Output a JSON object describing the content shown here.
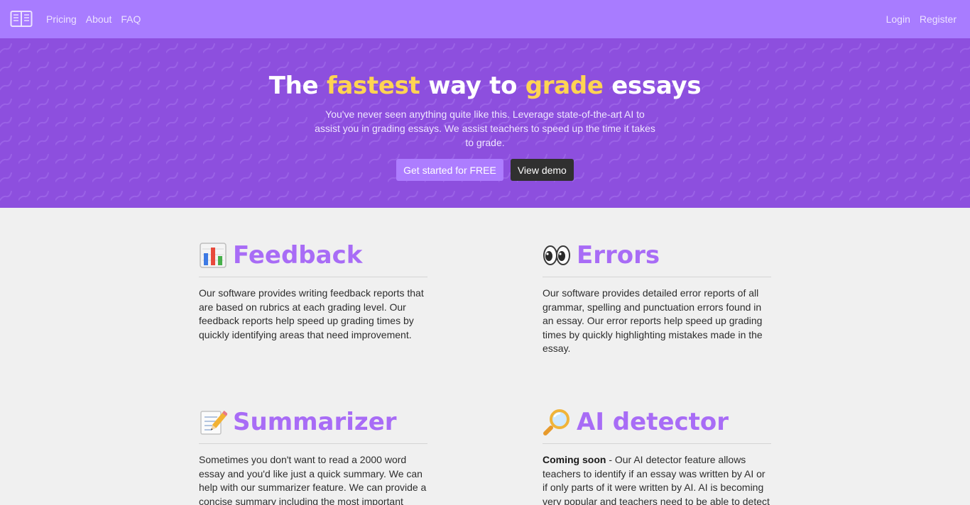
{
  "nav": {
    "logo": "book-icon",
    "links": [
      "Pricing",
      "About",
      "FAQ"
    ],
    "login": "Login",
    "register": "Register"
  },
  "hero": {
    "title_pre": "The",
    "title_accent1": "fastest",
    "title_mid": "way to",
    "title_accent2": "grade",
    "title_post": "essays",
    "subtitle": "You've never seen anything quite like this. Leverage state-of-the-art AI to assist you in grading essays. We assist teachers to speed up the time it takes to grade.",
    "cta_primary": "Get started for FREE",
    "cta_secondary": "View demo"
  },
  "features": [
    {
      "icon": "bar-chart-icon",
      "title": "Feedback",
      "text": "Our software provides writing feedback reports that are based on rubrics at each grading level. Our feedback reports help speed up grading times by quickly identifying areas that need improvement."
    },
    {
      "icon": "eyes-icon",
      "title": "Errors",
      "text": "Our software provides detailed error reports of all grammar, spelling and punctuation errors found in an essay. Our error reports help speed up grading times by quickly highlighting mistakes made in the essay."
    },
    {
      "icon": "memo-icon",
      "title": "Summarizer",
      "text": "Sometimes you don't want to read a 2000 word essay and you'd like just a quick summary. We can help with our summarizer feature. We can provide a concise summary including the most important information and"
    },
    {
      "icon": "magnifier-icon",
      "title": "AI detector",
      "badge": "Coming soon",
      "text": " - Our AI detector feature allows teachers to identify if an essay was written by AI or if only parts of it were written by AI. AI is becoming very popular and teachers need to be able to detect if essays are being"
    }
  ],
  "colors": {
    "nav_bg": "#a87cff",
    "hero_bg": "#8d4fde",
    "accent_yellow": "#ffd452",
    "feature_title": "#a86cf6",
    "button_primary": "#ad7dff",
    "button_dark": "#303030"
  }
}
